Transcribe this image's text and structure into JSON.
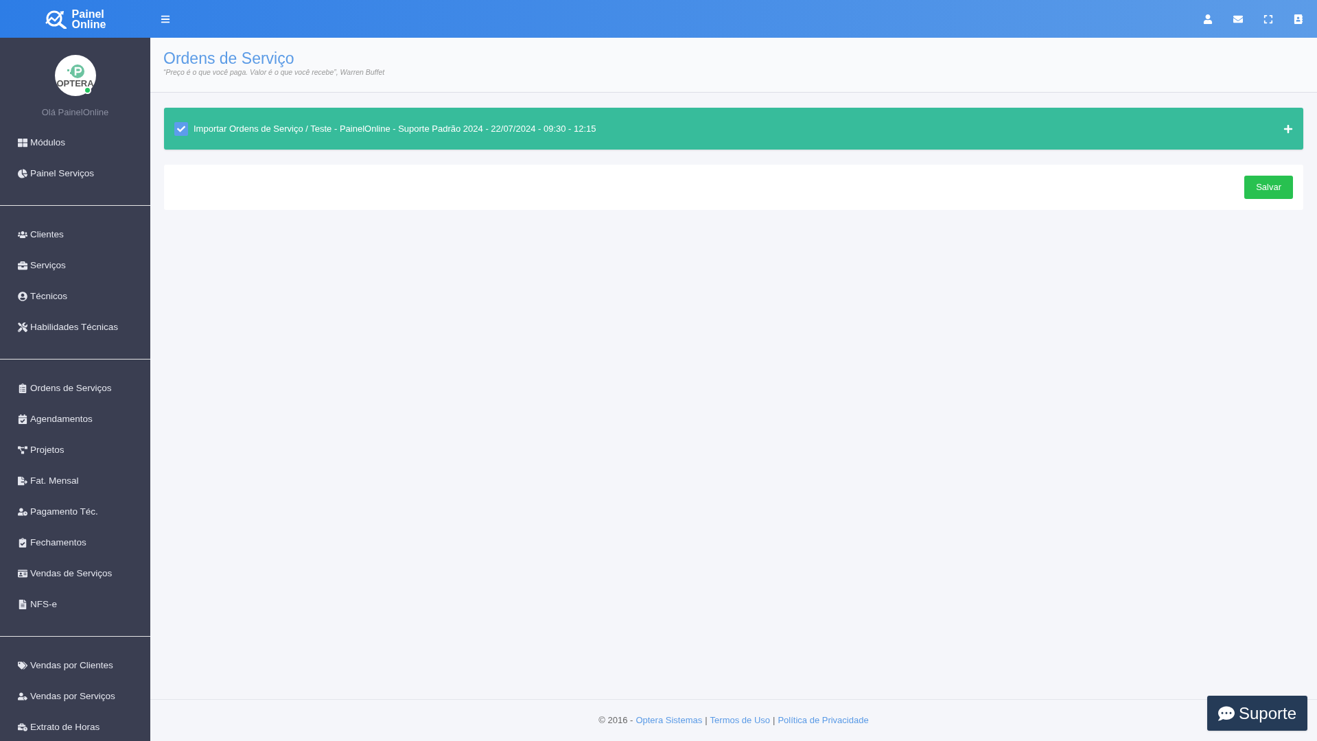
{
  "brand": {
    "line1": "Painel",
    "line2": "Online"
  },
  "user": {
    "avatar_text": "OPTERA",
    "online": true,
    "greeting": "Olá PainelOnline"
  },
  "sidebar": {
    "groups": [
      {
        "items": [
          "Módulos",
          "Painel Serviços"
        ]
      },
      {
        "items": [
          "Clientes",
          "Serviços",
          "Técnicos",
          "Habilidades Técnicas"
        ]
      },
      {
        "items": [
          "Ordens de Serviços",
          "Agendamentos",
          "Projetos",
          "Fat. Mensal",
          "Pagamento Téc.",
          "Fechamentos",
          "Vendas de Serviços",
          "NFS-e"
        ]
      },
      {
        "items": [
          "Vendas por Clientes",
          "Vendas por Serviços",
          "Extrato de Horas"
        ]
      }
    ]
  },
  "page": {
    "title": "Ordens de Serviço",
    "quote": "“Preço é o que você paga. Valor é o que você recebe”, Warren Buffet"
  },
  "import_panel": {
    "checked": true,
    "label": "Importar Ordens de Serviço / Teste - PainelOnline - Suporte Padrão 2024 - 22/07/2024 - 09:30 - 12:15",
    "expanded": false
  },
  "save_button": "Salvar",
  "footer": {
    "prefix": "© 2016 -",
    "separator": "|",
    "links": [
      "Optera Sistemas",
      "Termos de Uso",
      "Política de Privacidade"
    ]
  },
  "support_button": "Suporte"
}
